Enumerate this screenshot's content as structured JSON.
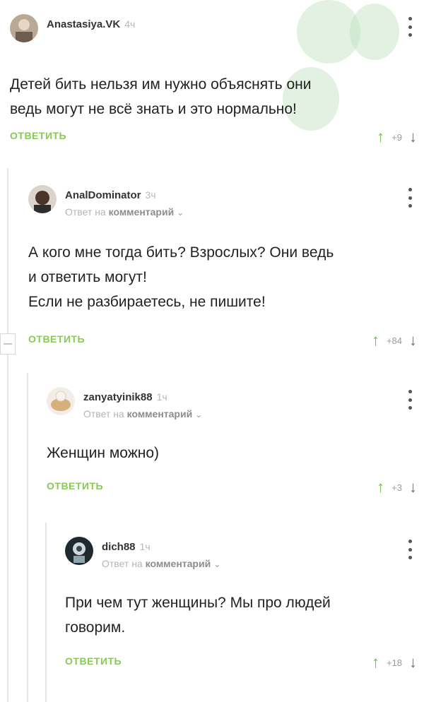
{
  "comments": [
    {
      "author": "Anastasiya.VK",
      "time": "4ч",
      "text_lines": [
        "Детей бить нельзя им нужно объяснять они",
        "ведь могут не всё знать и это нормально!"
      ],
      "reply_label": "ОТВЕТИТЬ",
      "votes": "+9"
    },
    {
      "author": "AnalDominator",
      "time": "3ч",
      "reply_prefix": "Ответ на",
      "reply_link": "комментарий",
      "text_lines": [
        "А кого мне тогда бить? Взрослых? Они ведь",
        "и ответить могут!",
        "Если не разбираетесь, не пишите!"
      ],
      "reply_label": "ОТВЕТИТЬ",
      "votes": "+84"
    },
    {
      "author": "zanyatyinik88",
      "time": "1ч",
      "reply_prefix": "Ответ на",
      "reply_link": "комментарий",
      "text_lines": [
        "Женщин можно)"
      ],
      "reply_label": "ОТВЕТИТЬ",
      "votes": "+3"
    },
    {
      "author": "dich88",
      "time": "1ч",
      "reply_prefix": "Ответ на",
      "reply_link": "комментарий",
      "text_lines": [
        "При чем тут женщины? Мы про людей",
        "говорим."
      ],
      "reply_label": "ОТВЕТИТЬ",
      "votes": "+18"
    }
  ],
  "icons": {
    "upvote": "↑",
    "downvote": "↓",
    "chevron": "⌄",
    "colors": {
      "reply": "#8ac858",
      "upvote": "#6fbf3e",
      "thread_line": "#e6e6e6"
    }
  }
}
